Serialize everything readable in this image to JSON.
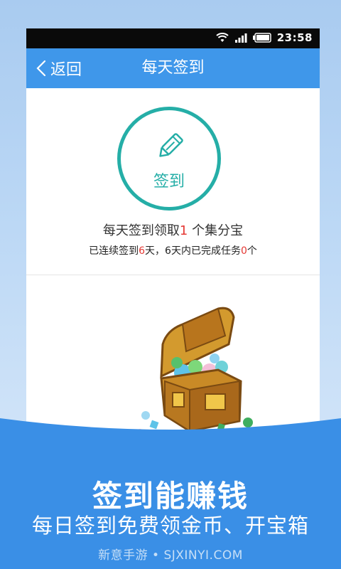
{
  "status_bar": {
    "time": "23:58",
    "icons": [
      "wifi-icon",
      "signal-icon",
      "battery-icon"
    ]
  },
  "navbar": {
    "back_label": "返回",
    "title": "每天签到"
  },
  "checkin": {
    "button_label": "签到",
    "reward_prefix": "每天签到领取",
    "reward_count": "1",
    "reward_suffix": " 个集分宝",
    "streak_prefix": "已连续签到",
    "streak_days": "6",
    "streak_mid": "天，6天内已完成任务",
    "tasks_done": "0",
    "tasks_suffix": "个"
  },
  "promo": {
    "headline": "签到能赚钱",
    "subline": "每日签到免费领金币、开宝箱",
    "watermark": "新意手游 • SJXINYI.COM"
  },
  "colors": {
    "navbar": "#3f97ea",
    "accent_teal": "#25aea7",
    "highlight_red": "#e53935",
    "banner_blue": "#3a8fe6"
  }
}
